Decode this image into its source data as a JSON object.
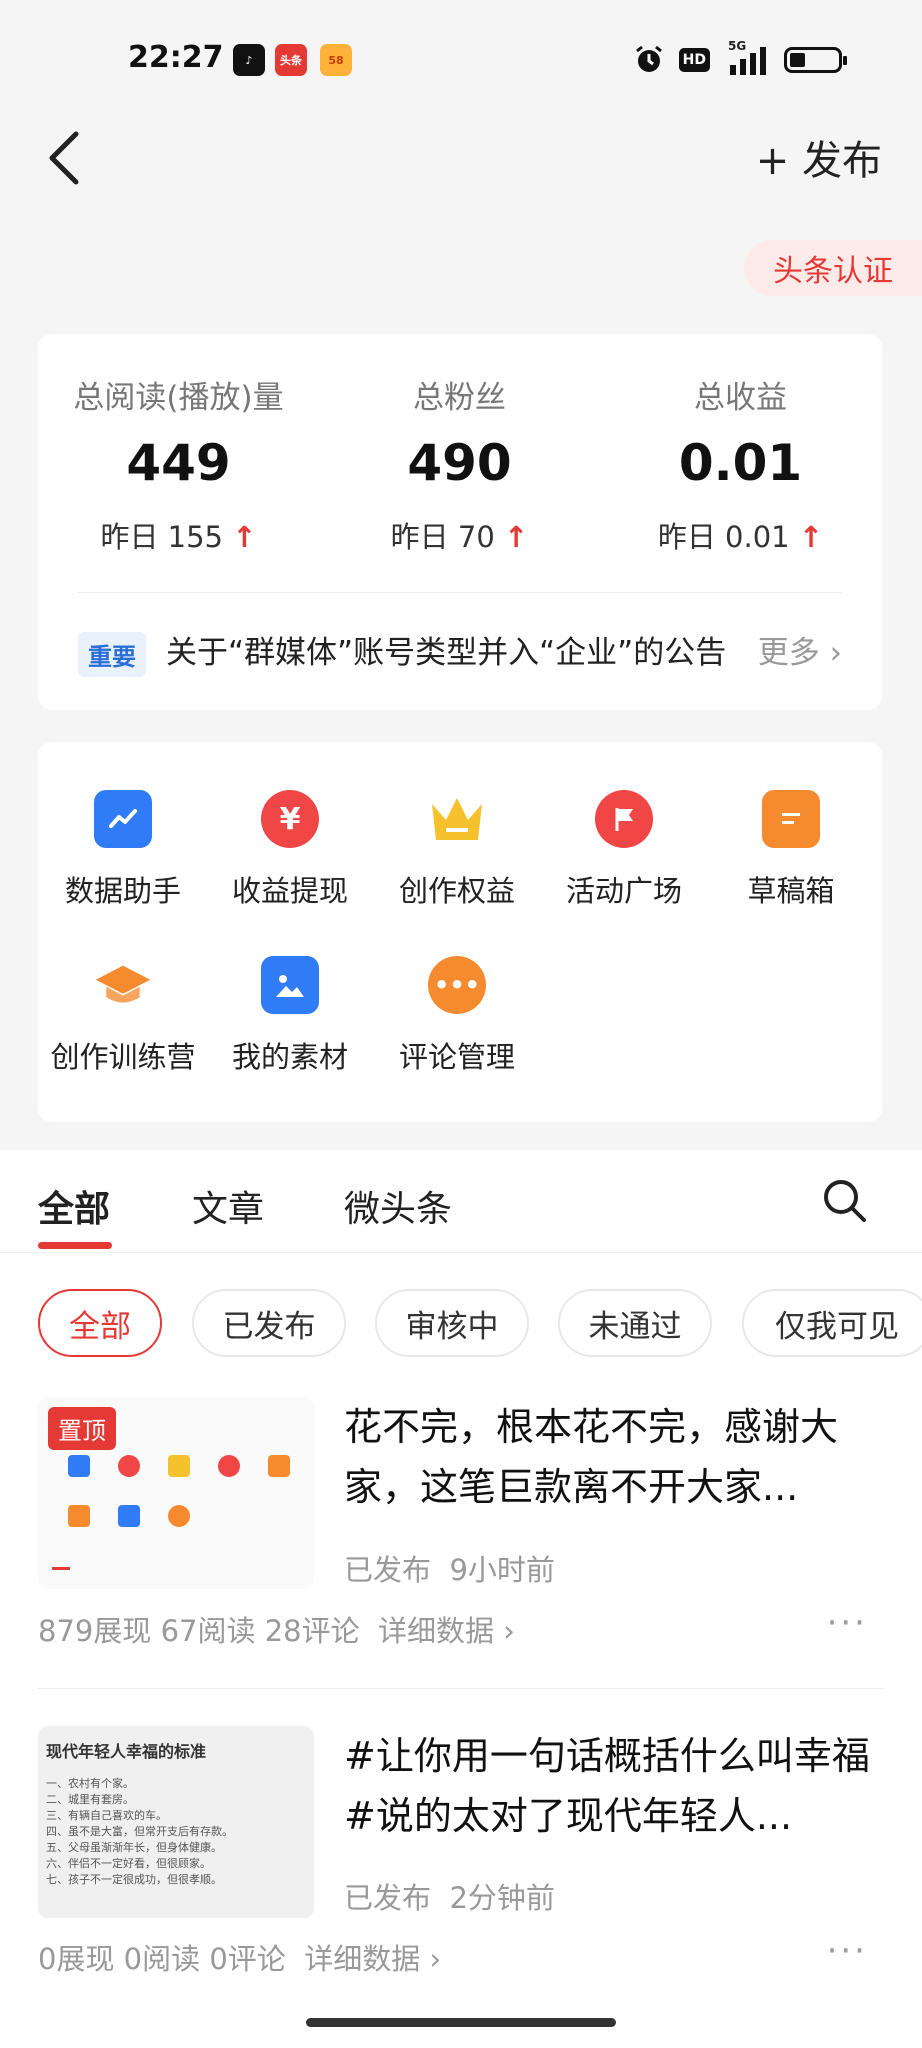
{
  "status_bar": {
    "time": "22:27",
    "apps": [
      {
        "icon": "tiktok-icon",
        "label": "",
        "color": "#111111"
      },
      {
        "icon": "toutiao-icon",
        "label": "头条",
        "color": "#e53935"
      },
      {
        "icon": "58-icon",
        "label": "58",
        "color": "#ff8a00"
      }
    ],
    "hd_label": "HD",
    "network_label": "5G"
  },
  "header": {
    "back_icon": "chevron-left-icon",
    "publish_label": "+ 发布",
    "cert_label": "头条认证"
  },
  "stats": [
    {
      "label": "总阅读(播放)量",
      "value": "449",
      "delta": "昨日 155"
    },
    {
      "label": "总粉丝",
      "value": "490",
      "delta": "昨日 70"
    },
    {
      "label": "总收益",
      "value": "0.01",
      "delta": "昨日 0.01"
    }
  ],
  "notice": {
    "tag": "重要",
    "text": "关于“群媒体”账号类型并入“企业”的公告",
    "more": "更多 ›"
  },
  "tools": [
    {
      "label": "数据助手",
      "icon": "chart-icon",
      "color": "#2f7cf6",
      "glyph": "↗"
    },
    {
      "label": "收益提现",
      "icon": "yuan-icon",
      "color": "#f04646",
      "glyph": "¥"
    },
    {
      "label": "创作权益",
      "icon": "crown-icon",
      "color": "#f5b82e",
      "glyph": "♛"
    },
    {
      "label": "活动广场",
      "icon": "flag-icon",
      "color": "#f04646",
      "glyph": "⚑"
    },
    {
      "label": "草稿箱",
      "icon": "draft-icon",
      "color": "#f58a2e",
      "glyph": "≡"
    },
    {
      "label": "创作训练营",
      "icon": "graduation-cap-icon",
      "color": "#f58a2e",
      "glyph": "🎓"
    },
    {
      "label": "我的素材",
      "icon": "image-icon",
      "color": "#2f7cf6",
      "glyph": "▲"
    },
    {
      "label": "评论管理",
      "icon": "comment-icon",
      "color": "#f58a2e",
      "glyph": "···"
    }
  ],
  "tabs": [
    "全部",
    "文章",
    "微头条"
  ],
  "filters": [
    "全部",
    "已发布",
    "审核中",
    "未通过",
    "仅我可见"
  ],
  "posts": [
    {
      "pinned_label": "置顶",
      "title": "花不完，根本花不完，感谢大家，这笔巨款离不开大家...",
      "status": "已发布",
      "time": "9小时前",
      "stats": "879展现  67阅读  28评论",
      "detail": "详细数据 ›",
      "thumb_title": "",
      "thumb_lines": []
    },
    {
      "pinned_label": "",
      "title": "#让你用一句话概括什么叫幸福#说的太对了现代年轻人...",
      "status": "已发布",
      "time": "2分钟前",
      "stats": "0展现  0阅读  0评论",
      "detail": "详细数据 ›",
      "thumb_title": "现代年轻人幸福的标准",
      "thumb_lines": [
        "一、农村有个家。",
        "二、城里有套房。",
        "三、有辆自己喜欢的车。",
        "四、虽不是大富，但常开支后有存款。",
        "五、父母虽渐渐年长，但身体健康。",
        "六、伴侣不一定好看，但很顾家。",
        "七、孩子不一定很成功，但很孝顺。"
      ]
    }
  ]
}
